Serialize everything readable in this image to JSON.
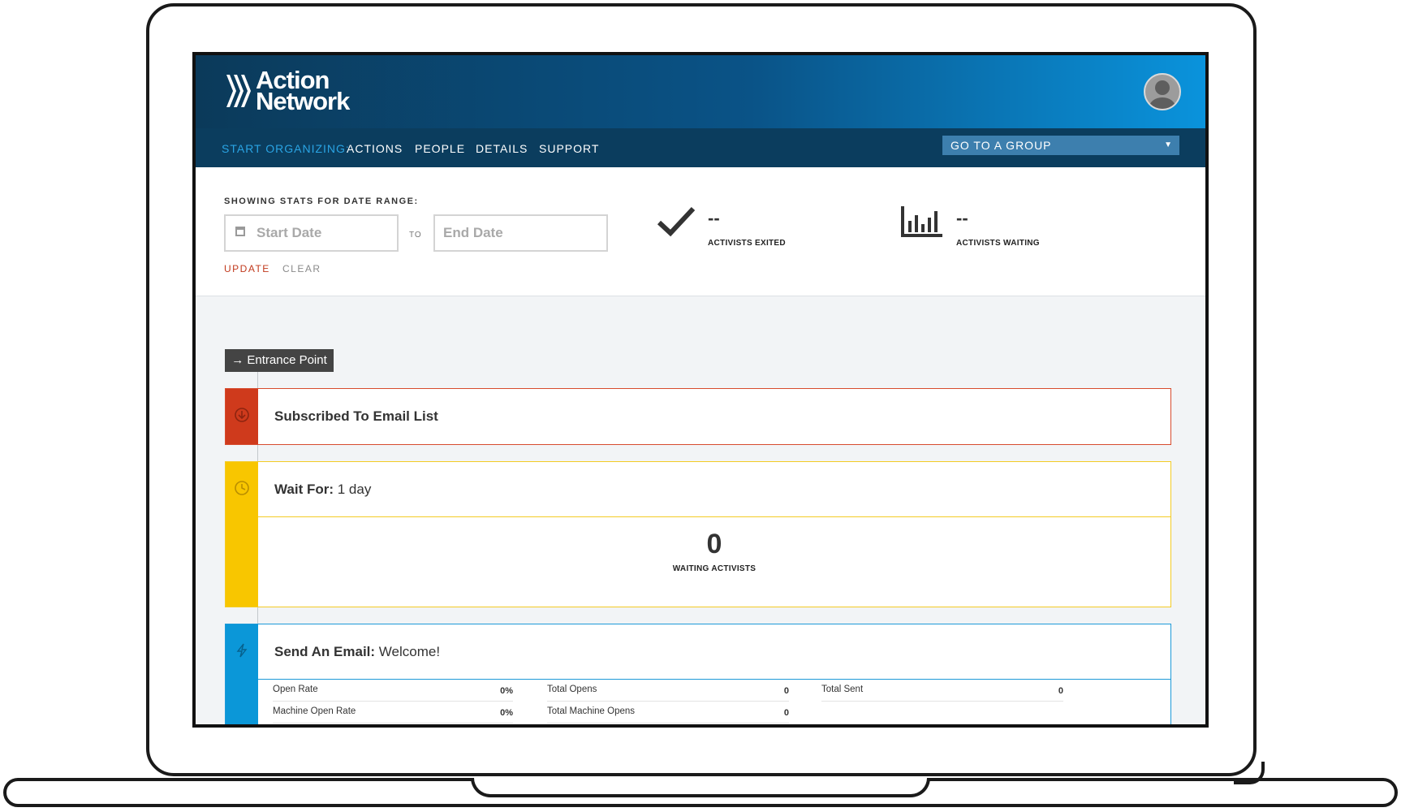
{
  "header": {
    "logo_line1": "Action",
    "logo_line2": "Network"
  },
  "nav": {
    "start_label": "START ORGANIZING:",
    "items": [
      "ACTIONS",
      "PEOPLE",
      "DETAILS",
      "SUPPORT"
    ],
    "group_select": "GO TO A GROUP"
  },
  "stats": {
    "range_label": "SHOWING STATS FOR DATE RANGE:",
    "start_placeholder": "Start Date",
    "to_label": "TO",
    "end_placeholder": "End Date",
    "update_label": "UPDATE",
    "clear_label": "CLEAR",
    "exited": {
      "value": "--",
      "label": "ACTIVISTS EXITED",
      "icon": "checkmark-icon"
    },
    "waiting": {
      "value": "--",
      "label": "ACTIVISTS WAITING",
      "icon": "bar-chart-icon"
    }
  },
  "ladder": {
    "entrance_label": "Entrance Point",
    "steps": [
      {
        "title_bold": "Subscribed To Email List",
        "title_rest": "",
        "icon": "arrow-down-circle-icon",
        "color": "#cf3a1c"
      },
      {
        "title_bold": "Wait For:",
        "title_rest": " 1 day",
        "icon": "clock-icon",
        "color": "#f8c600",
        "count": "0",
        "count_label": "WAITING ACTIVISTS"
      },
      {
        "title_bold": "Send An Email:",
        "title_rest": " Welcome!",
        "icon": "lightning-icon",
        "color": "#0b97d8",
        "metrics": [
          {
            "label": "Open Rate",
            "value": "0%"
          },
          {
            "label": "Total Opens",
            "value": "0"
          },
          {
            "label": "Total Sent",
            "value": "0"
          },
          {
            "label": "Machine Open Rate",
            "value": "0%"
          },
          {
            "label": "Total Machine Opens",
            "value": "0"
          }
        ]
      }
    ]
  }
}
